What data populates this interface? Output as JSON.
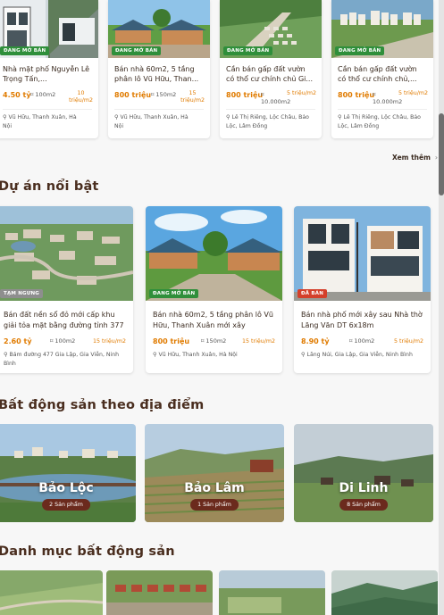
{
  "top_listings": [
    {
      "badge": "ĐANG MỞ BÁN",
      "title": "Nhà mặt phố Nguyễn Lê Trọng Tấn,...",
      "price": "4.50 tỷ",
      "area": "100m2",
      "price_per_m2_line1": "10",
      "price_per_m2_line2": "triệu/m2",
      "location_line1": "Vũ Hữu, Thanh Xuân, Hà",
      "location_line2": "Nội"
    },
    {
      "badge": "ĐANG MỞ BÁN",
      "title": "Bán nhà 60m2, 5 tầng phân lô Vũ Hữu, Than...",
      "price": "800 triệu",
      "area": "150m2",
      "price_per_m2_line1": "15",
      "price_per_m2_line2": "triệu/m2",
      "location_line1": "Vũ Hữu, Thanh Xuân, Hà",
      "location_line2": "Nội"
    },
    {
      "badge": "ĐANG MỞ BÁN",
      "title": "Cần bán gấp đất vườn có thổ cư chính chủ Gi...",
      "price": "800 triệu",
      "area": "10.000m2",
      "price_per_m2_line1": "5 triệu/m2",
      "price_per_m2_line2": "",
      "location_line1": "Lê Thị Riêng, Lộc Châu, Bảo",
      "location_line2": "Lộc, Lâm Đồng"
    },
    {
      "badge": "ĐANG MỞ BÁN",
      "title": "Cần bán gấp đất vườn có thổ cư chính chủ,...",
      "price": "800 triệu",
      "area": "10.000m2",
      "price_per_m2_line1": "5 triệu/m2",
      "price_per_m2_line2": "",
      "location_line1": "Lê Thị Riêng, Lộc Châu, Bảo",
      "location_line2": "Lộc, Lâm Đồng"
    }
  ],
  "see_more": "Xem thêm",
  "sections": {
    "featured": "Dự án nổi bật",
    "by_location": "Bất động sản theo địa điểm",
    "categories": "Danh mục bất động sản"
  },
  "featured_projects": [
    {
      "badge": "TẠM NGƯNG",
      "title": "Bán đất nền sổ đỏ mới cấp khu giải tỏa mặt bằng đường tỉnh 377",
      "price": "2.60 tỷ",
      "area": "100m2",
      "price_per_m2": "15 triệu/m2",
      "location_line1": "Bám đường 477 Gia Lập, Gia Viễn, Ninh",
      "location_line2": "Bình"
    },
    {
      "badge": "ĐANG MỞ BÁN",
      "title": "Bán nhà 60m2, 5 tầng phân lô Vũ Hữu, Thanh Xuân mới xây",
      "price": "800 triệu",
      "area": "150m2",
      "price_per_m2": "15 triệu/m2",
      "location_line1": "Vũ Hữu, Thanh Xuân, Hà Nội",
      "location_line2": ""
    },
    {
      "badge": "ĐÃ BÁN",
      "title": "Bán nhà phố mới xây sau Nhà thờ Lăng Văn DT 6x18m",
      "price": "8.90 tỷ",
      "area": "100m2",
      "price_per_m2": "5 triệu/m2",
      "location_line1": "Lăng Núi, Gia Lập, Gia Viễn, Ninh Bình",
      "location_line2": ""
    }
  ],
  "locations": [
    {
      "name": "Bảo Lộc",
      "count": "2 Sản phẩm"
    },
    {
      "name": "Bảo Lâm",
      "count": "1 Sản phẩm"
    },
    {
      "name": "Di Linh",
      "count": "8 Sản phẩm"
    }
  ],
  "colors": {
    "accent_price": "#e07b00",
    "badge_open": "#2f8f3b",
    "badge_sold": "#d4402b",
    "pill": "#6b2a1d",
    "heading": "#4a2e1f"
  },
  "icons": {
    "area": "area-icon",
    "location": "map-pin-icon",
    "see_more": "chevron-right-icon"
  }
}
